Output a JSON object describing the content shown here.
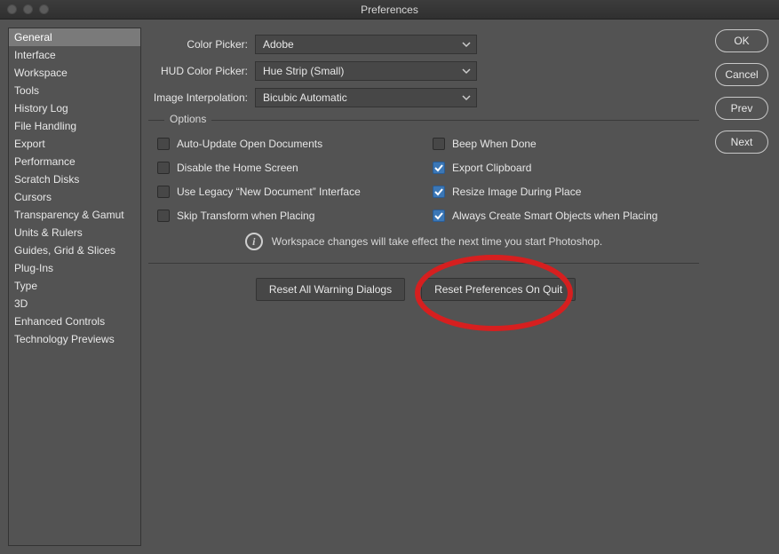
{
  "window": {
    "title": "Preferences"
  },
  "sidebar": {
    "items": [
      "General",
      "Interface",
      "Workspace",
      "Tools",
      "History Log",
      "File Handling",
      "Export",
      "Performance",
      "Scratch Disks",
      "Cursors",
      "Transparency & Gamut",
      "Units & Rulers",
      "Guides, Grid & Slices",
      "Plug-Ins",
      "Type",
      "3D",
      "Enhanced Controls",
      "Technology Previews"
    ],
    "selected_index": 0
  },
  "right_buttons": [
    "OK",
    "Cancel",
    "Prev",
    "Next"
  ],
  "pickers": {
    "color_picker_label": "Color Picker:",
    "color_picker_value": "Adobe",
    "hud_label": "HUD Color Picker:",
    "hud_value": "Hue Strip (Small)",
    "interp_label": "Image Interpolation:",
    "interp_value": "Bicubic Automatic"
  },
  "options": {
    "legend": "Options",
    "left": [
      {
        "label": "Auto-Update Open Documents",
        "checked": false
      },
      {
        "label": "Disable the Home Screen",
        "checked": false
      },
      {
        "label": "Use Legacy “New Document” Interface",
        "checked": false
      },
      {
        "label": "Skip Transform when Placing",
        "checked": false
      }
    ],
    "right": [
      {
        "label": "Beep When Done",
        "checked": false
      },
      {
        "label": "Export Clipboard",
        "checked": true
      },
      {
        "label": "Resize Image During Place",
        "checked": true
      },
      {
        "label": "Always Create Smart Objects when Placing",
        "checked": true
      }
    ],
    "warning": "Workspace changes will take effect the next time you start Photoshop."
  },
  "bottom_buttons": {
    "reset_warnings": "Reset All Warning Dialogs",
    "reset_prefs": "Reset Preferences On Quit"
  }
}
